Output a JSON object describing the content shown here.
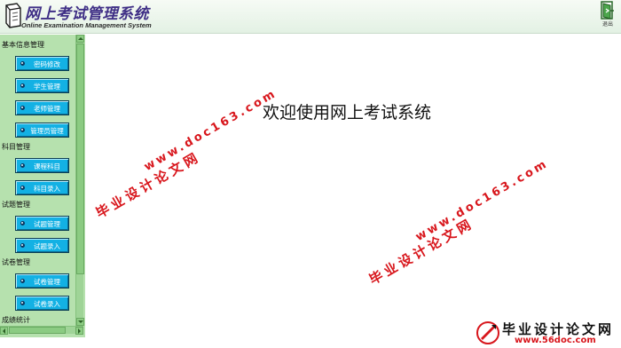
{
  "header": {
    "title": "网上考试管理系统",
    "subtitle": "Online Examination Management System",
    "logout_label": "退出"
  },
  "sidebar": {
    "sections": [
      {
        "title": "基本信息管理",
        "items": [
          "密码修改",
          "学生管理",
          "老师管理",
          "管理员管理"
        ]
      },
      {
        "title": "科目管理",
        "items": [
          "课程科目",
          "科目录入"
        ]
      },
      {
        "title": "试题管理",
        "items": [
          "试题管理",
          "试题录入"
        ]
      },
      {
        "title": "试卷管理",
        "items": [
          "试卷管理",
          "试卷录入"
        ]
      },
      {
        "title": "成绩统计",
        "items": []
      }
    ]
  },
  "main": {
    "welcome": "欢迎使用网上考试系统"
  },
  "watermark": {
    "site_name": "毕业设计论文网",
    "url": "www.doc163.com"
  },
  "corner_logo": {
    "title": "毕业设计论文网",
    "url": "www.56doc.com"
  },
  "colors": {
    "header_bg": "#e3f1e4",
    "sidebar_bg": "#b6e1ae",
    "nav_button": "#13b1e4",
    "title_text": "#3f2f86",
    "watermark": "#d8161c"
  }
}
